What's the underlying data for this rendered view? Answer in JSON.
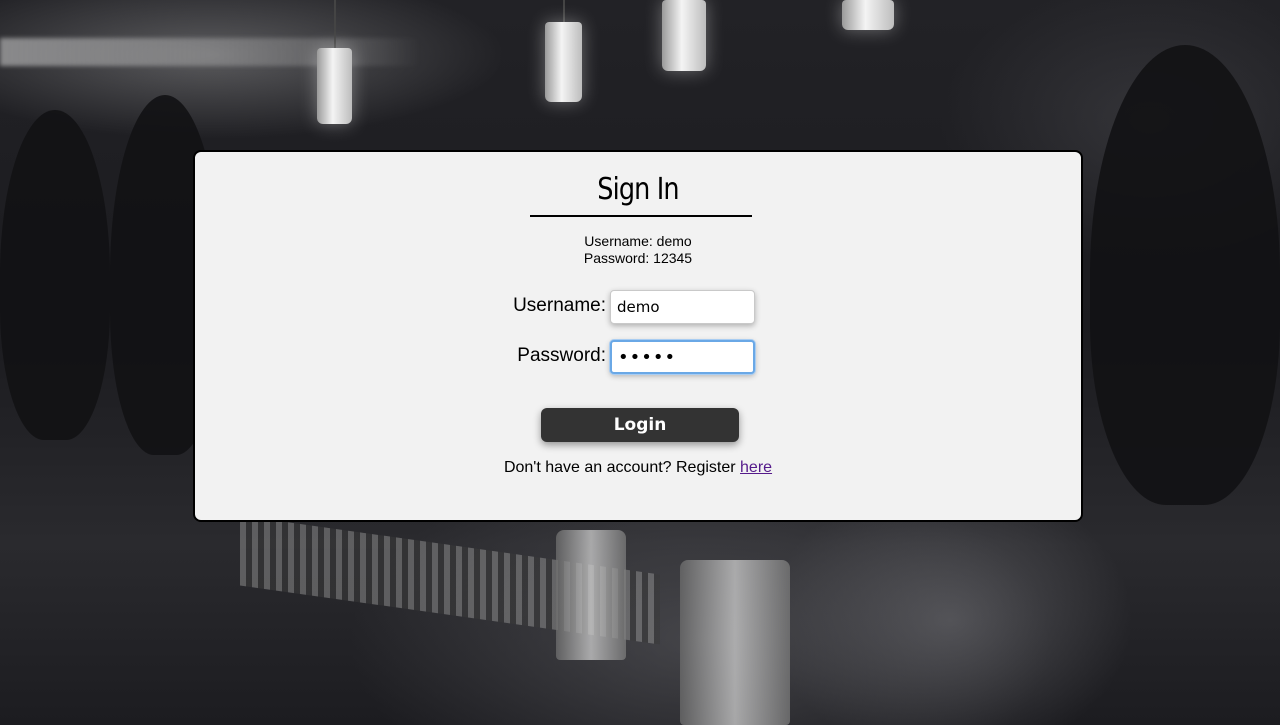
{
  "signin": {
    "title": "Sign In",
    "hint_username": "Username: demo",
    "hint_password": "Password: 12345",
    "username_label": "Username:",
    "username_value": "demo",
    "password_label": "Password:",
    "password_value": "12345",
    "login_button": "Login",
    "register_prompt": "Don't have an account? Register",
    "register_link": "here"
  },
  "colors": {
    "card_background": "#f2f2f2",
    "button_background": "#333333",
    "focus_ring": "#6aa8e6",
    "link": "#551a8b"
  }
}
